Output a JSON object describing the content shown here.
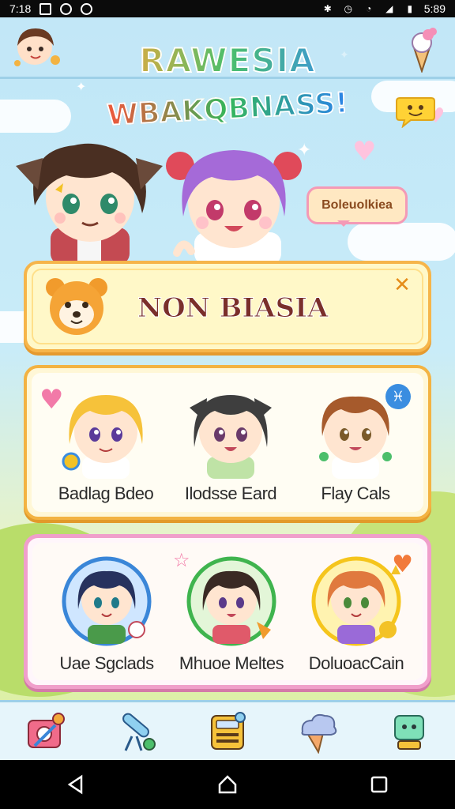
{
  "status_bar": {
    "time_left": "7:18",
    "time_right": "5:89",
    "icons": [
      "gallery-icon",
      "message-icon",
      "record-icon",
      "bluetooth-icon",
      "alarm-icon",
      "wifi-icon",
      "signal-icon",
      "battery-icon"
    ]
  },
  "header": {
    "title": "RAWESIA",
    "subtitle": "WBAKQBNASS!",
    "avatar_icon": "girl-avatar-icon",
    "menu_icon": "ice-cream-icon",
    "bubble_icon": "smiley-chat-icon"
  },
  "hero": {
    "speech_text": "Boleuolkiea",
    "characters": [
      "brown-hair-boy",
      "purple-hair-girl"
    ]
  },
  "banner": {
    "title": "NON BIASIA",
    "mascot_icon": "bear-mascot-icon",
    "close_icon": "close-icon"
  },
  "cards_row_1": [
    {
      "name": "Badlag Bdeo",
      "hair": "#f6c23a",
      "bg": "#fff0c2"
    },
    {
      "name": "Ilodsse Eard",
      "hair": "#3e3e3e",
      "bg": "#e9f2ff"
    },
    {
      "name": "Flay Cals",
      "hair": "#a65a2c",
      "bg": "#fff7e8"
    }
  ],
  "cards_row_2": [
    {
      "name": "Uae Sgclads",
      "hair": "#27325e",
      "ring": "#3a86d8"
    },
    {
      "name": "Mhuoe Meltes",
      "hair": "#3a2a24",
      "ring": "#3fb44e"
    },
    {
      "name": "DoluoacCain",
      "hair": "#e0793e",
      "ring": "#f5c51c"
    }
  ],
  "bottom_nav": [
    {
      "icon": "camera-edit-icon"
    },
    {
      "icon": "telescope-icon"
    },
    {
      "icon": "calculator-icon"
    },
    {
      "icon": "cloud-icecream-icon"
    },
    {
      "icon": "robot-icon"
    }
  ],
  "system_nav": [
    "back-icon",
    "home-icon",
    "recents-icon"
  ],
  "colors": {
    "sky": "#c9ecf8",
    "panel_gold": "#f3b342",
    "panel_pink": "#f09fcb",
    "banner_bg": "#fff8c8"
  }
}
